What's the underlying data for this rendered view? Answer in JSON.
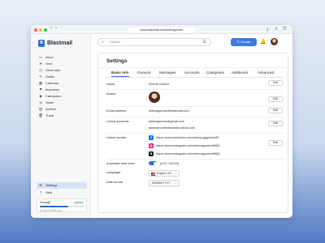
{
  "browser": {
    "url": "www.blastmail.com/selenagomez",
    "back_arrow": "‹",
    "forward_arrow": "›"
  },
  "app": {
    "logo_letter": "B",
    "name": "Blastmail"
  },
  "sidebar": {
    "items": [
      {
        "label": "Inbox",
        "icon": "inbox-icon",
        "glyph": "▭"
      },
      {
        "label": "Sent",
        "icon": "send-icon",
        "glyph": "➤"
      },
      {
        "label": "Send later",
        "icon": "clock-icon",
        "glyph": "◷"
      },
      {
        "label": "Drafts",
        "icon": "draft-icon",
        "glyph": "✎"
      },
      {
        "label": "Calendar",
        "icon": "calendar-icon",
        "glyph": "▦"
      },
      {
        "label": "Important",
        "icon": "important-icon",
        "glyph": "⚑"
      },
      {
        "label": "Categories",
        "icon": "tag-icon",
        "glyph": "◆"
      },
      {
        "label": "Spam",
        "icon": "spam-icon",
        "glyph": "⊘"
      },
      {
        "label": "Archive",
        "icon": "archive-icon",
        "glyph": "▤"
      },
      {
        "label": "Trash",
        "icon": "trash-icon",
        "glyph": "🗑"
      }
    ],
    "bottom_items": [
      {
        "label": "Settings",
        "icon": "gear-icon",
        "glyph": "⚙",
        "active": true
      },
      {
        "label": "Help",
        "icon": "help-icon",
        "glyph": "?"
      }
    ],
    "storage": {
      "title": "Storage",
      "upgrade": "Upgrade",
      "summary": "9.6 GB of 15 GB used",
      "used_fraction": 0.64
    }
  },
  "topbar": {
    "search_placeholder": "Search",
    "create_label": "Create"
  },
  "settings": {
    "title": "Settings",
    "tabs": [
      "Basic Info",
      "General",
      "Messages",
      "Accounts",
      "Categories",
      "Additional",
      "Advanced"
    ],
    "active_tab": "Basic Info",
    "edit_label": "Edit",
    "fields": {
      "name_label": "Name:",
      "name_value": "Selena Gomez",
      "avatar_label": "Avatar:",
      "email_label": "Email address:",
      "email_value": "selenagomez@blastmail.com",
      "linked_accounts_label": "Linked accounts:",
      "linked_accounts": [
        "selenagomez@gmail.com",
        "storiesfromtheheart@outlook.com"
      ],
      "linked_socials_label": "Linked socials:",
      "socials": [
        {
          "network": "facebook",
          "icon": "facebook-icon",
          "glyph": "f",
          "color": "#1877f2",
          "url": "https://www.facebook.com/selena.gggomez89"
        },
        {
          "network": "instagram",
          "icon": "instagram-icon",
          "glyph": "◎",
          "color": "#d62976",
          "url": "https://www.instagram.com/selenagomez9888/"
        },
        {
          "network": "x",
          "icon": "x-icon",
          "glyph": "𝕏",
          "color": "#111111",
          "url": "https://www.instagram.com/selenagomez9888/"
        }
      ],
      "timezone_label": "Automatic time zone:",
      "timezone_value": "(UTC +04:00)",
      "language_label": "Language:",
      "language_value": "English US",
      "dateformat_label": "Date format:",
      "dateformat_value": "DD/MM/YYYY",
      "chevron": "⌄"
    }
  },
  "colors": {
    "accent": "#2f6fd6",
    "create_button": "#3d7ddc"
  }
}
